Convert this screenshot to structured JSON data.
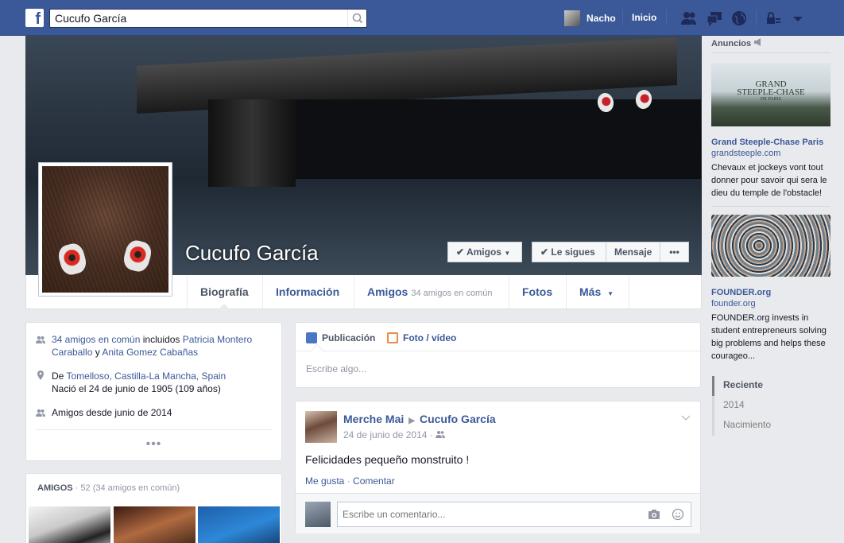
{
  "topbar": {
    "logo": "f",
    "search_value": "Cucufo García",
    "user_name": "Nacho",
    "home_label": "Inicio"
  },
  "profile": {
    "name": "Cucufo García",
    "buttons": {
      "friends": "Amigos",
      "following": "Le sigues",
      "message": "Mensaje",
      "more": "•••"
    }
  },
  "tabs": [
    {
      "label": "Biografía",
      "sub": ""
    },
    {
      "label": "Información",
      "sub": ""
    },
    {
      "label": "Amigos",
      "sub": "34 amigos en común"
    },
    {
      "label": "Fotos",
      "sub": ""
    },
    {
      "label": "Más",
      "sub": ""
    }
  ],
  "intro": {
    "mutual_link": "34 amigos en común",
    "mutual_mid": " incluidos ",
    "mutual_friend1": "Patricia Montero Caraballo",
    "mutual_and": " y ",
    "mutual_friend2": "Anita Gomez Cabañas",
    "from_prefix": "De ",
    "from_place": "Tomelloso, Castilla-La Mancha, Spain",
    "born": "Nació el 24 de junio de 1905 (109 años)",
    "friends_since": "Amigos desde junio de 2014",
    "more": "•••"
  },
  "friends_card": {
    "title": "AMIGOS",
    "count": " · 52 (34 amigos en común)"
  },
  "composer": {
    "tab_post": "Publicación",
    "tab_photo": "Foto / vídeo",
    "placeholder": "Escribe algo..."
  },
  "post": {
    "author": "Merche Mai",
    "target": "Cucufo García",
    "date": "24 de junio de 2014 ·",
    "text": "Felicidades pequeño monstruito !",
    "like": "Me gusta",
    "dot": " · ",
    "comment": "Comentar",
    "comment_placeholder": "Escribe un comentario..."
  },
  "ads": {
    "title": "Anuncios",
    "items": [
      {
        "title": "Grand Steeple-Chase Paris",
        "domain": "grandsteeple.com",
        "body": "Chevaux et jockeys vont tout donner pour savoir qui sera le dieu du temple de l'obstacle!",
        "image_text_1": "GRAND",
        "image_text_2": "STEEPLE-CHASE",
        "image_text_3": "DE PARIS"
      },
      {
        "title": "FOUNDER.org",
        "domain": "founder.org",
        "body": "FOUNDER.org invests in student entrepreneurs solving big problems and helps these courageo..."
      }
    ]
  },
  "timeline_nav": [
    "Reciente",
    "2014",
    "Nacimiento"
  ],
  "colors": {
    "brand": "#3b5998",
    "background": "#e9eaed",
    "eye_red": "#d92a20"
  }
}
